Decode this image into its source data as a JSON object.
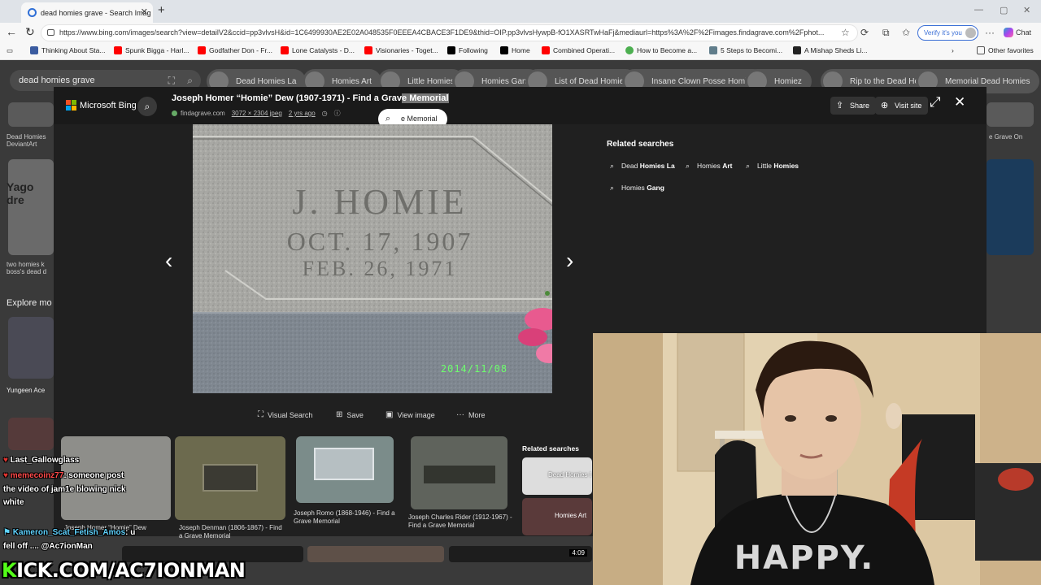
{
  "browser": {
    "tab_title": "dead homies grave - Search Imag",
    "url": "https://www.bing.com/images/search?view=detailV2&ccid=pp3vlvsH&id=1C6499930AE2E02A048535F0EEEA4CBACE3F1DE9&thid=OIP.pp3vlvsHywpB-fO1XASRTwHaFj&mediaurl=https%3A%2F%2Fimages.findagrave.com%2Fphot...",
    "verify_label": "Verify it's you",
    "chat_label": "Chat",
    "bookmarks": [
      {
        "label": "Thinking About Sta...",
        "color": "#ff0000"
      },
      {
        "label": "Spunk Bigga - Harl...",
        "color": "#ff0000"
      },
      {
        "label": "Godfather Don - Fr...",
        "color": "#ff0000"
      },
      {
        "label": "Lone Catalysts - D...",
        "color": "#ff0000"
      },
      {
        "label": "Visionaries - Toget...",
        "color": "#ff0000"
      },
      {
        "label": "Following",
        "color": "#000000"
      },
      {
        "label": "Home",
        "color": "#000000"
      },
      {
        "label": "Combined Operati...",
        "color": "#ff0000"
      },
      {
        "label": "How to Become a...",
        "color": "#4caf50"
      },
      {
        "label": "5 Steps to Becomi...",
        "color": "#607d8b"
      },
      {
        "label": "A Mishap Sheds Li...",
        "color": "#222222"
      }
    ],
    "other_favorites": "Other favorites"
  },
  "background_page": {
    "search_query": "dead homies grave",
    "chips": [
      {
        "label": "Dead Homies La"
      },
      {
        "label": "Homies Art"
      },
      {
        "label": "Little Homies"
      },
      {
        "label": "Homies Gang"
      },
      {
        "label": "List of Dead Homies"
      },
      {
        "label": "Insane Clown Posse Homies"
      },
      {
        "label": "Homiez"
      },
      {
        "label": "Rip to the Dead Homies"
      },
      {
        "label": "Memorial Dead Homies"
      }
    ],
    "left_caption_1": "Dead Homies DeviantArt",
    "left_caption_2": "two homies k boss's dead d",
    "left_thumb_text": "Yago dre",
    "explore_label": "Explore mo",
    "yungeen_label": "Yungeen Ace",
    "right_caption": "e Grave On"
  },
  "modal": {
    "brand": "Microsoft Bing",
    "title_main": "Joseph Homer “Homie” Dew (1907-1971) - Find a Grav",
    "title_highlight": "e Memorial",
    "source": "findagrave.com",
    "dimensions": "3072 × 2304 jpeg",
    "age": "2 yrs ago",
    "selection_search": "e Memorial",
    "share_label": "Share",
    "visit_label": "Visit site",
    "headstone": {
      "name": "J. HOMIE",
      "born": "OCT. 17, 1907",
      "died": "FEB. 26, 1971",
      "stamp": "2014/11/08"
    },
    "related_title": "Related searches",
    "related": [
      {
        "prefix": "Dead ",
        "bold": "Homies La"
      },
      {
        "prefix": "Homies ",
        "bold": "Art"
      },
      {
        "prefix": "Little ",
        "bold": "Homies"
      },
      {
        "prefix": "Homies ",
        "bold": "Gang"
      }
    ],
    "actions": {
      "visual_search": "Visual Search",
      "save": "Save",
      "view_image": "View image",
      "more": "More"
    },
    "strip": [
      {
        "caption": "Joseph Homer “Homie” Dew"
      },
      {
        "caption": "Joseph Denman (1806-1867) - Find a Grave Memorial"
      },
      {
        "caption": "Joseph Romo (1868-1946) - Find a Grave Memorial"
      },
      {
        "caption": "Joseph Charles Rider (1912-1967) - Find a Grave Memorial"
      }
    ],
    "strip_related_title": "Related searches",
    "strip_related": [
      {
        "label": "Dead Homies I"
      },
      {
        "label": "Homies Art"
      }
    ],
    "duration": "4:09"
  },
  "stream": {
    "chat": [
      {
        "user": "Last_Gallowglass",
        "text": "",
        "color": "#ffffff"
      },
      {
        "user": "memecoinz77",
        "text": ": someone post",
        "color": "#ff4a4a"
      },
      {
        "user": "",
        "text": "the video of jam1e blowing nick",
        "color": "#ffffff"
      },
      {
        "user": "",
        "text": "white",
        "color": "#ffffff"
      },
      {
        "user": "Kameron_Scat_Fetish_Amos",
        "text": ": u",
        "color": "#5fd3ff"
      },
      {
        "user": "",
        "text": "fell off .... @Ac7ionMan",
        "color": "#ffffff"
      }
    ],
    "kick_prefix": "K",
    "kick_rest": "ICK.COM/AC7IONMAN",
    "shirt_text": "HAPPY."
  }
}
